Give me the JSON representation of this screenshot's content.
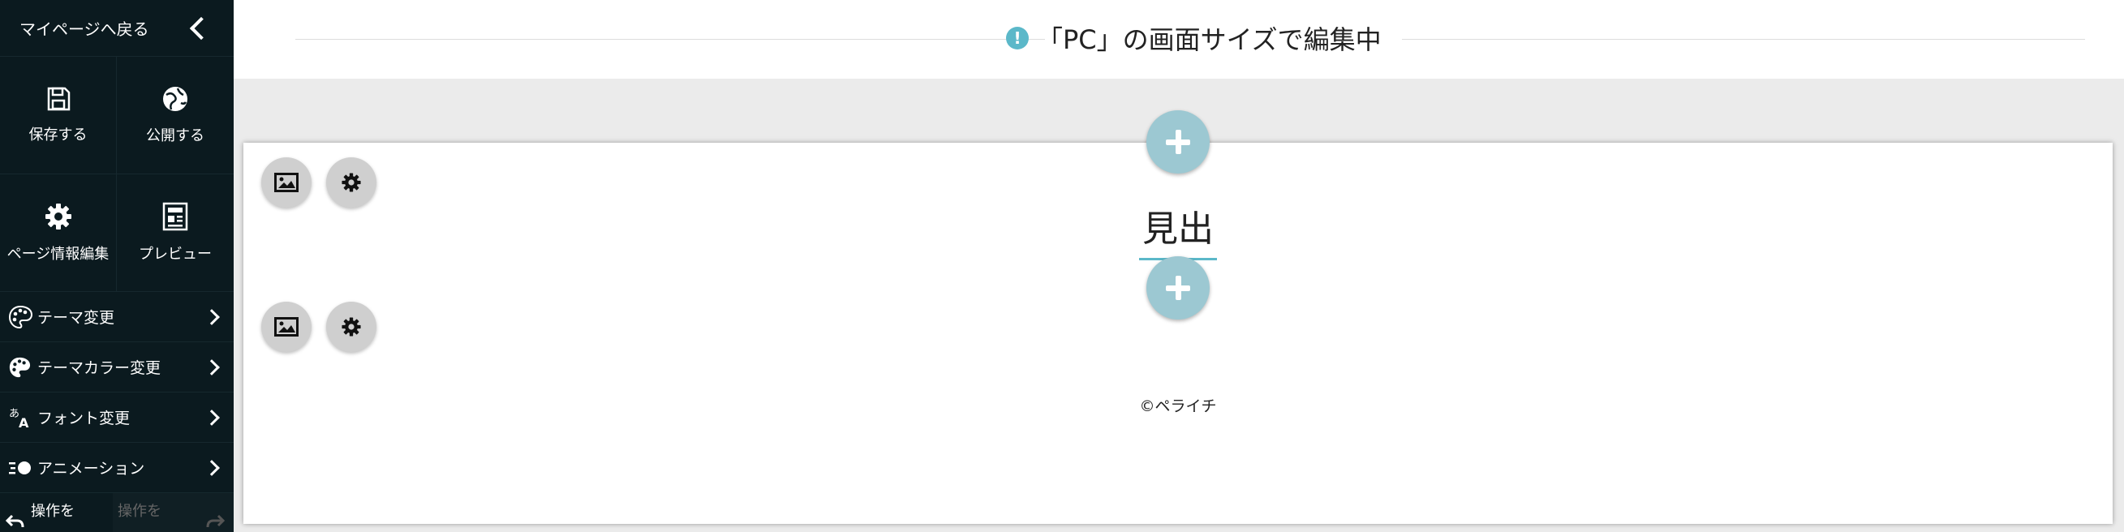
{
  "sidebar": {
    "back_label": "マイページへ戻る",
    "grid": [
      {
        "label": "保存する",
        "icon": "save-icon"
      },
      {
        "label": "公開する",
        "icon": "globe-icon"
      },
      {
        "label": "ページ情報編集",
        "icon": "gear-icon"
      },
      {
        "label": "プレビュー",
        "icon": "preview-icon"
      }
    ],
    "menu": [
      {
        "label": "テーマ変更",
        "icon": "palette-icon"
      },
      {
        "label": "テーマカラー変更",
        "icon": "palette-icon"
      },
      {
        "label": "フォント変更",
        "icon": "font-icon"
      },
      {
        "label": "アニメーション",
        "icon": "animation-icon"
      }
    ],
    "undo_label": "操作を",
    "redo_label": "操作を"
  },
  "topbar": {
    "message": "「PC」の画面サイズで編集中",
    "info_icon_text": "!"
  },
  "editor": {
    "heading": "見出し",
    "copyright": "©ペライチ"
  },
  "colors": {
    "sidebar_bg": "#0b1a1f",
    "accent": "#5bb8c9",
    "add_button": "#9cc8d2"
  }
}
